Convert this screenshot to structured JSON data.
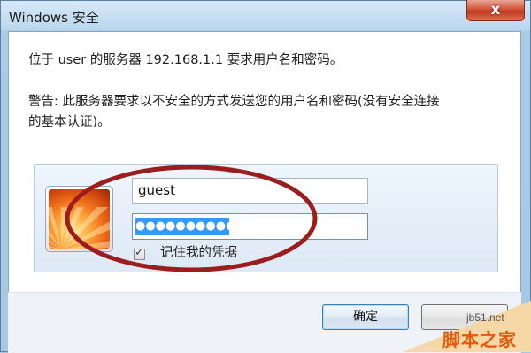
{
  "window": {
    "title": "Windows 安全",
    "close_label": "x"
  },
  "message": {
    "line1": "位于 user 的服务器 192.168.1.1 要求用户名和密码。",
    "warning_line1": "警告: 此服务器要求以不安全的方式发送您的用户名和密码(没有安全连接",
    "warning_line2": "的基本认证)。"
  },
  "credentials": {
    "username_value": "guest",
    "password_value": "●●●●●●●●●●",
    "remember_label": "记住我的凭据",
    "remember_checked": true
  },
  "buttons": {
    "ok_label": "确定"
  },
  "annotation": {
    "color": "#9b1d1d"
  },
  "watermark": {
    "line1": "jb51.net",
    "line2": "脚本之家"
  }
}
